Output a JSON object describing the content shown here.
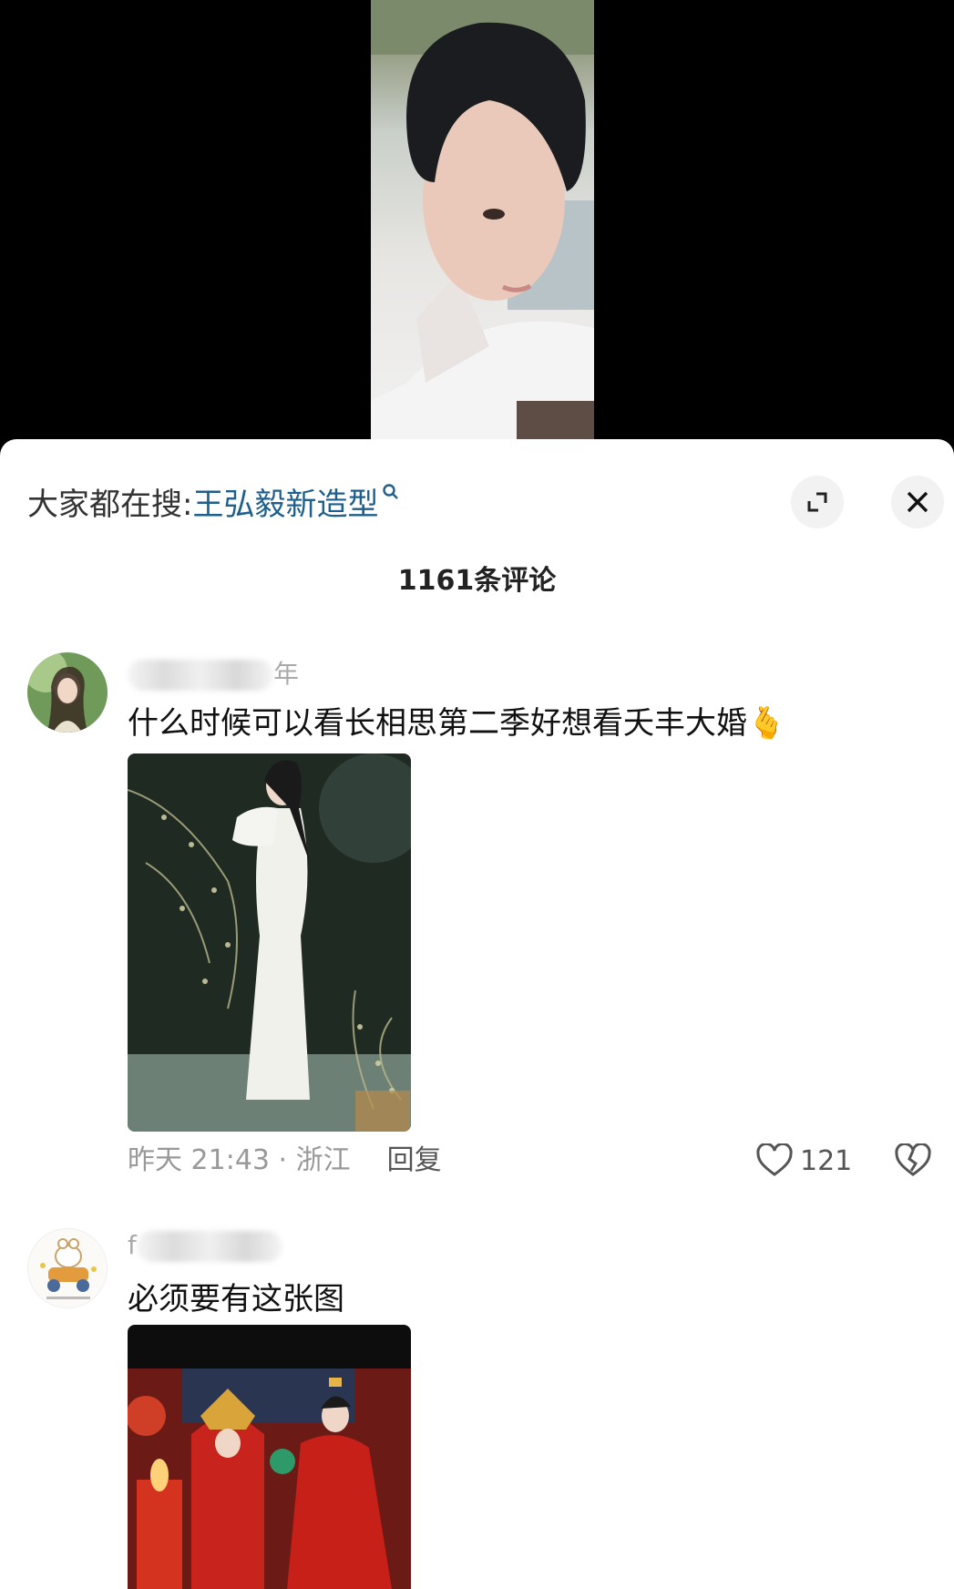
{
  "search": {
    "prefix": "大家都在搜:",
    "term": "王弘毅新造型"
  },
  "comments_count": "1161条评论",
  "comments": [
    {
      "username_visible": "年",
      "text": "什么时候可以看长相思第二季好想看夭丰大婚",
      "emoji": "🫰",
      "time_location": "昨天 21:43 · 浙江",
      "reply": "回复",
      "likes": "121"
    },
    {
      "username_visible": "f",
      "text": "必须要有这张图"
    }
  ]
}
